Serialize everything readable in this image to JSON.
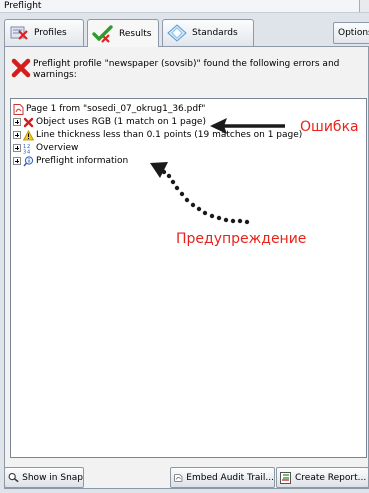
{
  "window": {
    "title": "Preflight"
  },
  "tabs": [
    {
      "label": "Profiles",
      "icon": "profiles-icon"
    },
    {
      "label": "Results",
      "icon": "checkmark-icon",
      "active": true
    },
    {
      "label": "Standards",
      "icon": "standards-icon"
    }
  ],
  "options_label": "Options",
  "summary": {
    "icon": "error-x-icon",
    "message": "Preflight profile \"newspaper (sovsib)\" found the following errors and warnings:"
  },
  "tree": {
    "root": {
      "label": "Page 1 from \"sosedi_07_okrug1_36.pdf\"",
      "icon": "pdf-icon"
    },
    "items": [
      {
        "label": "Object uses RGB (1 match on 1 page)",
        "icon": "error-x-icon"
      },
      {
        "label": "Line thickness less than 0.1 points (19 matches on 1 page)",
        "icon": "warning-icon"
      },
      {
        "label": "Overview",
        "icon": "overview-icon"
      },
      {
        "label": "Preflight information",
        "icon": "info-icon"
      }
    ]
  },
  "annotations": {
    "error_label": "Ошибка",
    "warning_label": "Предупреждение",
    "color": "#e8231b"
  },
  "buttons": {
    "show_in_snap": "Show in Snap",
    "embed_audit_trail": "Embed Audit Trail...",
    "create_report": "Create Report..."
  }
}
